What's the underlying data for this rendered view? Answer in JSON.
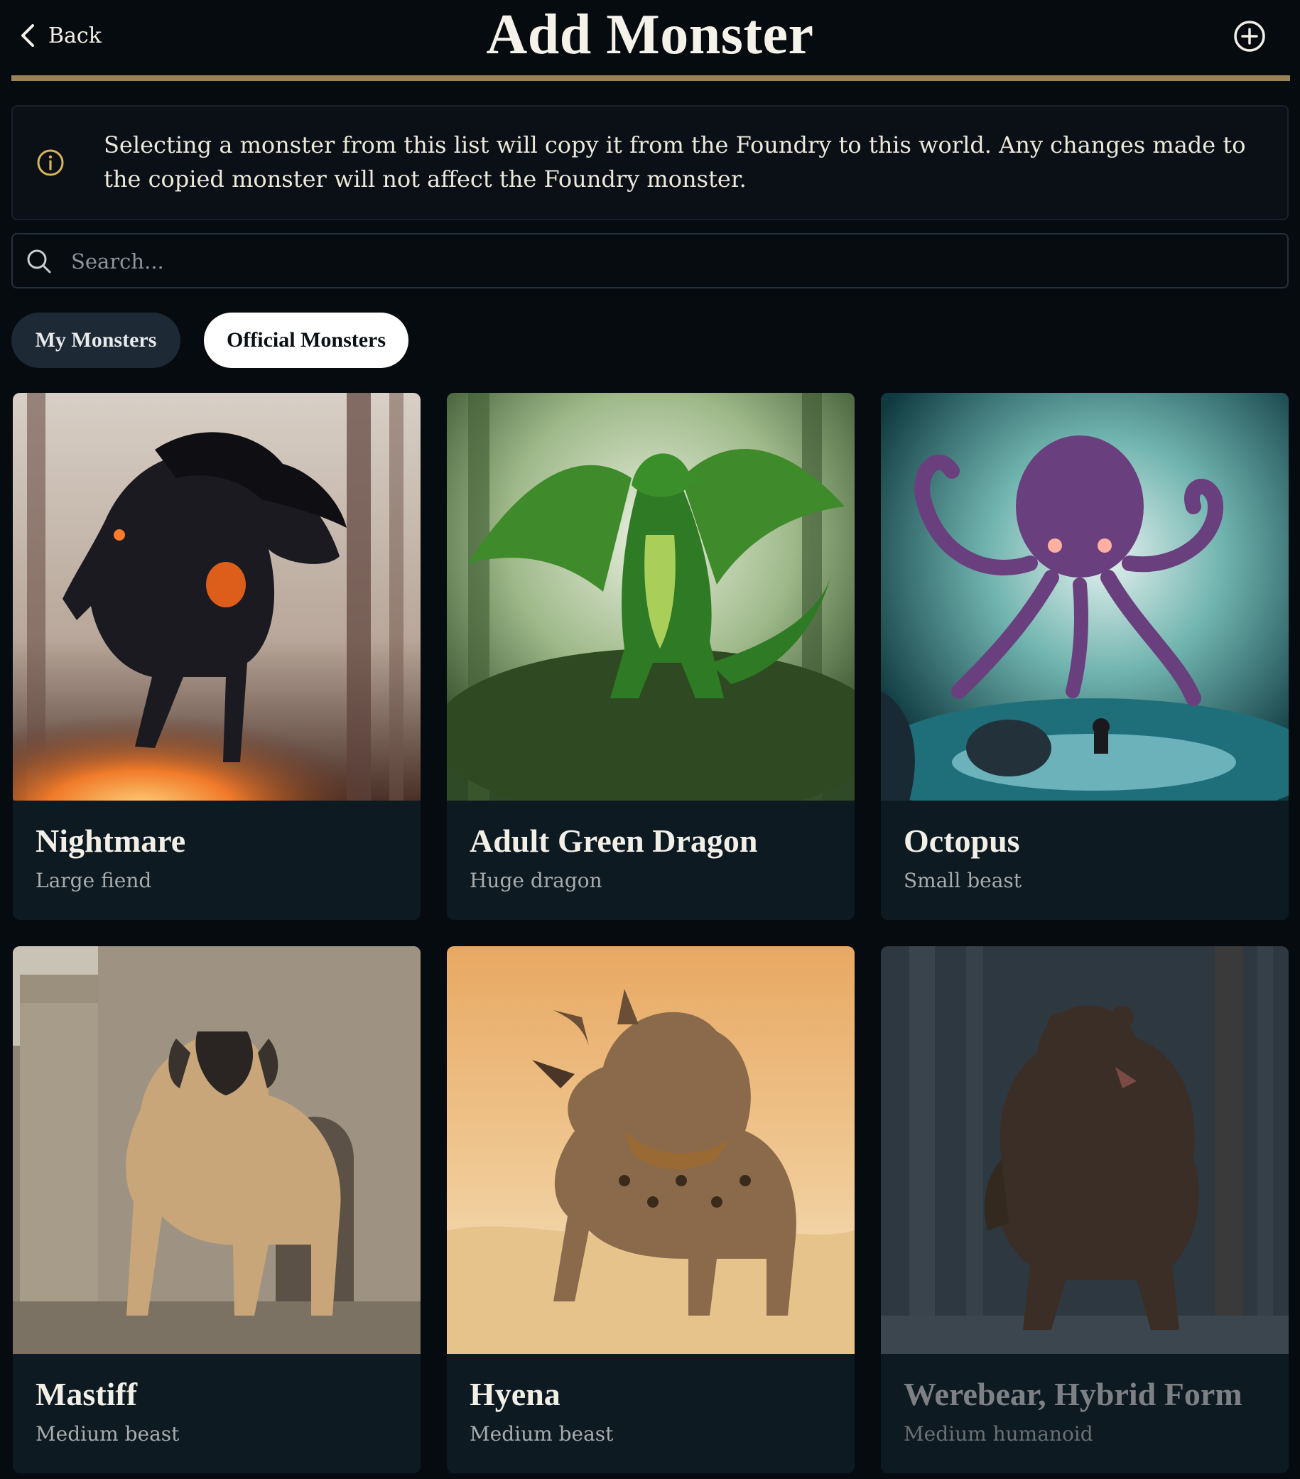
{
  "header": {
    "back_label": "Back",
    "title": "Add Monster",
    "add_icon": "plus-circle-icon"
  },
  "info": {
    "icon": "info-circle-icon",
    "text": "Selecting a monster from this list will copy it from the Foundry to this world. Any changes made to the copied monster will not affect the Foundry monster."
  },
  "search": {
    "placeholder": "Search...",
    "value": ""
  },
  "tabs": [
    {
      "label": "My Monsters",
      "active": false
    },
    {
      "label": "Official Monsters",
      "active": true
    }
  ],
  "monsters": [
    {
      "name": "Nightmare",
      "type": "Large fiend"
    },
    {
      "name": "Adult Green Dragon",
      "type": "Huge dragon"
    },
    {
      "name": "Octopus",
      "type": "Small beast"
    },
    {
      "name": "Mastiff",
      "type": "Medium beast"
    },
    {
      "name": "Hyena",
      "type": "Medium beast"
    },
    {
      "name": "Werebear, Hybrid Form",
      "type": "Medium humanoid"
    }
  ],
  "colors": {
    "background": "#060b10",
    "accent_rule": "#9a8257",
    "info_icon": "#d9b45a",
    "card_bg": "#0d1a22",
    "tab_active_bg": "#ffffff",
    "tab_inactive_bg": "#1d2935"
  }
}
